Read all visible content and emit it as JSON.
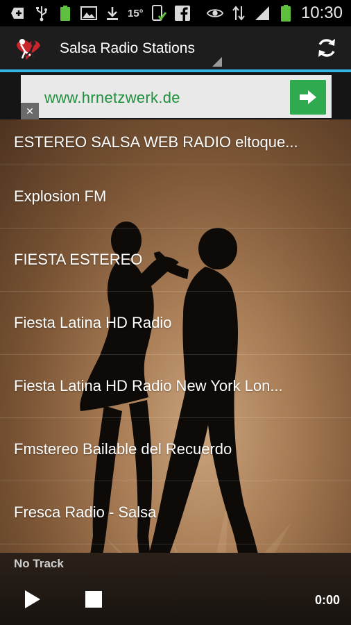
{
  "status_bar": {
    "icons_left": [
      "add-icon",
      "usb-icon",
      "battery-icon",
      "image-icon",
      "download-icon",
      "temperature-icon",
      "phone-check-icon",
      "facebook-icon"
    ],
    "temperature": "15°",
    "icons_right": [
      "eye-icon",
      "data-arrows-icon",
      "signal-icon",
      "battery-icon"
    ],
    "time": "10:30"
  },
  "action_bar": {
    "title": "Salsa Radio Stations",
    "refresh_icon": "refresh-icon"
  },
  "ad": {
    "url": "www.hrnetzwerk.de",
    "go_icon": "arrow-right-icon",
    "close_label": "✕"
  },
  "stations": [
    "ESTEREO SALSA WEB RADIO eltoque...",
    "Explosion FM",
    "FIESTA ESTEREO",
    "Fiesta Latina HD Radio",
    "Fiesta Latina HD Radio New York Lon...",
    "Fmstereo Bailable del Recuerdo",
    "Fresca Radio - Salsa"
  ],
  "player": {
    "track": "No Track",
    "time": "0:00",
    "play_icon": "play-icon",
    "stop_icon": "stop-icon"
  },
  "colors": {
    "accent": "#33b5e5",
    "ad_text": "#1e8f3c",
    "ad_button": "#2faa4f",
    "background_brown": "#a97d56"
  }
}
